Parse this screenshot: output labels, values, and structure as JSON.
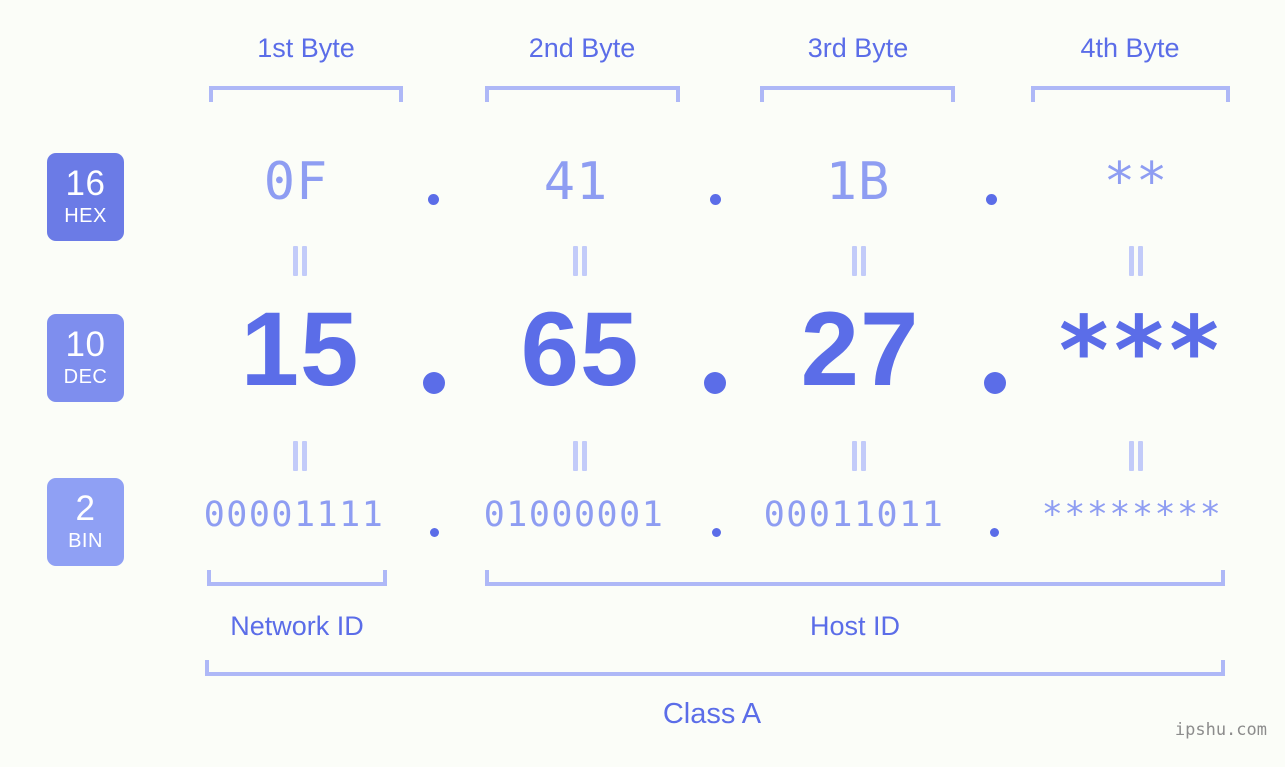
{
  "page": {
    "background_color": "#FBFDF8",
    "accent_dark": "#5B6DE8",
    "accent_light": "#8E9DF2",
    "bracket_color": "#AEB8F7",
    "watermark": "ipshu.com"
  },
  "byte_headers": [
    {
      "label": "1st Byte"
    },
    {
      "label": "2nd Byte"
    },
    {
      "label": "3rd Byte"
    },
    {
      "label": "4th Byte"
    }
  ],
  "rows": [
    {
      "key": "hex",
      "badge_number": "16",
      "badge_abbr": "HEX",
      "badge_color": "#6B7BE6",
      "values": [
        "0F",
        "41",
        "1B",
        "**"
      ],
      "separator": "."
    },
    {
      "key": "dec",
      "badge_number": "10",
      "badge_abbr": "DEC",
      "badge_color": "#7E8EEE",
      "values": [
        "15",
        "65",
        "27",
        "***"
      ],
      "separator": "."
    },
    {
      "key": "bin",
      "badge_number": "2",
      "badge_abbr": "BIN",
      "badge_color": "#8FA0F4",
      "values": [
        "00001111",
        "01000001",
        "00011011",
        "********"
      ],
      "separator": "."
    }
  ],
  "equality_symbol": "=",
  "segments": {
    "network_id": "Network ID",
    "host_id": "Host ID"
  },
  "class": {
    "label": "Class A"
  }
}
